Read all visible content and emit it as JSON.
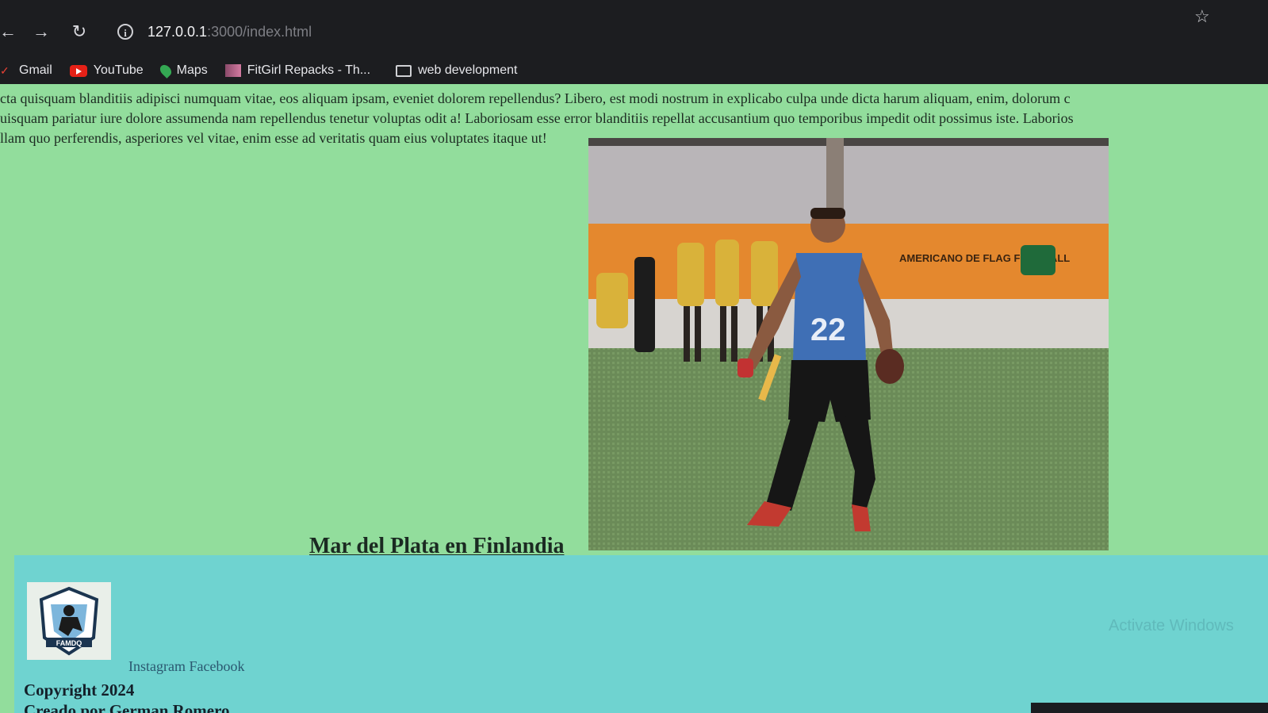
{
  "browser": {
    "url_host": "127.0.0.1",
    "url_path": ":3000/index.html",
    "bookmarks": [
      {
        "label": "Gmail",
        "icon": "gmail-icon"
      },
      {
        "label": "YouTube",
        "icon": "youtube-icon"
      },
      {
        "label": "Maps",
        "icon": "maps-icon"
      },
      {
        "label": "FitGirl Repacks - Th...",
        "icon": "site-favicon"
      },
      {
        "label": "web development",
        "icon": "folder-icon"
      }
    ]
  },
  "content": {
    "paragraph_lines": [
      "cta quisquam blanditiis adipisci numquam vitae, eos aliquam ipsam, eveniet dolorem repellendus? Libero, est modi nostrum in explicabo culpa unde dicta harum aliquam, enim, dolorum c",
      "uisquam pariatur iure dolore assumenda nam repellendus tenetur voluptas odit a! Laboriosam esse error blanditiis repellat accusantium quo temporibus impedit odit possimus iste. Laborios",
      "llam quo perferendis, asperiores vel vitae, enim esse ad veritatis quam eius voluptates itaque ut!"
    ],
    "image_banner_text": "AMERICANO DE FLAG FOOTBALL",
    "jersey_number": "22",
    "caption": "Mar del Plata en Finlandia"
  },
  "footer": {
    "logo_text": "FAMDQ",
    "instagram": "Instagram",
    "facebook": "Facebook",
    "copyright": "Copyright 2024",
    "credit": "Creado por German Romero",
    "watermark": "Activate Windows"
  },
  "colors": {
    "page_bg": "#92dd9c",
    "footer_bg": "#6fd3d0",
    "chrome_bg": "#1c1d20"
  }
}
